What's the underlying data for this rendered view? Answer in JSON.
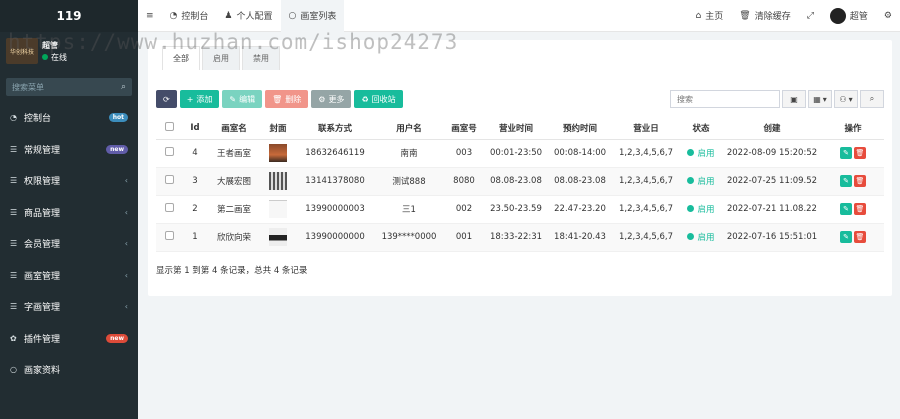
{
  "sidebar": {
    "brand": "119",
    "user": {
      "name": "超管",
      "status": "在线",
      "logo_text": "华创科技"
    },
    "search_placeholder": "搜索菜单",
    "items": [
      {
        "label": "控制台",
        "icon": "dashboard-icon",
        "badge": "hot"
      },
      {
        "label": "常规管理",
        "icon": "list-icon",
        "badge": "new"
      },
      {
        "label": "权限管理",
        "icon": "list-icon",
        "chevron": "‹"
      },
      {
        "label": "商品管理",
        "icon": "list-icon",
        "chevron": "‹"
      },
      {
        "label": "会员管理",
        "icon": "list-icon",
        "chevron": "‹"
      },
      {
        "label": "画室管理",
        "icon": "list-icon",
        "chevron": "‹"
      },
      {
        "label": "字画管理",
        "icon": "list-icon",
        "chevron": "‹"
      },
      {
        "label": "插件管理",
        "icon": "puzzle-icon",
        "badge": "new"
      },
      {
        "label": "画家资料",
        "icon": "circle-icon"
      }
    ]
  },
  "topbar": {
    "menu_icon": "≡",
    "tabs": [
      {
        "label": "控制台",
        "icon": "dashboard-icon"
      },
      {
        "label": "个人配置",
        "icon": "user-icon"
      },
      {
        "label": "画室列表",
        "icon": "circle-icon"
      }
    ],
    "right": {
      "home": "主页",
      "clear_cache": "清除缓存",
      "admin": "超管"
    }
  },
  "watermark": "https://www.huzhan.com/ishop24273",
  "content": {
    "tabs": [
      "全部",
      "启用",
      "禁用"
    ],
    "toolbar": {
      "add": "添加",
      "edit": "编辑",
      "delete": "删除",
      "more": "更多",
      "recycle": "回收站",
      "search_placeholder": "搜索"
    },
    "columns": [
      "Id",
      "画室名",
      "封面",
      "联系方式",
      "用户名",
      "画室号",
      "营业时间",
      "预约时间",
      "营业日",
      "状态",
      "创建",
      "操作"
    ],
    "rows": [
      {
        "id": "4",
        "name": "王者画室",
        "phone": "18632646119",
        "user": "南南",
        "room": "003",
        "hours": "00:01-23:50",
        "appt": "00:08-14:00",
        "days": "1,2,3,4,5,6,7",
        "status": "启用",
        "created": "2022-08-09 15:20:52"
      },
      {
        "id": "3",
        "name": "大展宏图",
        "phone": "13141378080",
        "user": "测试888",
        "room": "8080",
        "hours": "08.08-23.08",
        "appt": "08.08-23.08",
        "days": "1,2,3,4,5,6,7",
        "status": "启用",
        "created": "2022-07-25 11:09.52"
      },
      {
        "id": "2",
        "name": "第二画室",
        "phone": "13990000003",
        "user": "三1",
        "room": "002",
        "hours": "23.50-23.59",
        "appt": "22.47-23.20",
        "days": "1,2,3,4,5,6,7",
        "status": "启用",
        "created": "2022-07-21 11.08.22"
      },
      {
        "id": "1",
        "name": "欣欣向荣",
        "phone": "13990000000",
        "user": "139****0000",
        "room": "001",
        "hours": "18:33-22:31",
        "appt": "18:41-20.43",
        "days": "1,2,3,4,5,6,7",
        "status": "启用",
        "created": "2022-07-16 15:51:01"
      }
    ],
    "footer": "显示第 1 到第 4 条记录，总共 4 条记录"
  },
  "colors": {
    "sidebar_bg": "#222d32",
    "accent_green": "#18bc9c",
    "danger": "#e74c3c",
    "hot_badge": "#3c8dbc",
    "new_badge": "#605ca8"
  }
}
